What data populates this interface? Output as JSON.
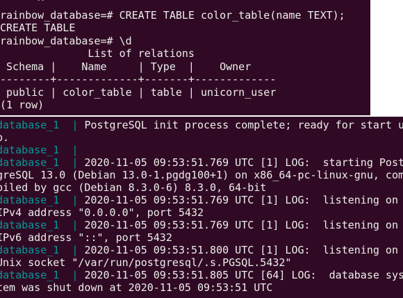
{
  "psql_window": {
    "lines": [
      "      ^",
      "rainbow_database=# CREATE TABLE color_table(name TEXT);",
      "CREATE TABLE",
      "rainbow_database=# \\d",
      "              List of relations",
      " Schema |    Name     | Type  |    Owner",
      "--------+-------------+-------+-------------",
      " public | color_table | table | unicorn_user",
      "(1 row)"
    ]
  },
  "log_window": {
    "prefix": "database_1  ",
    "separator": "| ",
    "colors": {
      "background": "#300a24",
      "prefix": "#06989a",
      "text": "#eeeeec"
    },
    "lines": [
      {
        "prefix": true,
        "text": "PostgreSQL init process complete; ready for start u"
      },
      {
        "prefix": false,
        "text": "p."
      },
      {
        "prefix": true,
        "text": ""
      },
      {
        "prefix": true,
        "text": "2020-11-05 09:53:51.769 UTC [1] LOG:  starting Post"
      },
      {
        "prefix": false,
        "text": "greSQL 13.0 (Debian 13.0-1.pgdg100+1) on x86_64-pc-linux-gnu, com"
      },
      {
        "prefix": false,
        "text": "piled by gcc (Debian 8.3.0-6) 8.3.0, 64-bit"
      },
      {
        "prefix": true,
        "text": "2020-11-05 09:53:51.769 UTC [1] LOG:  listening on"
      },
      {
        "prefix": false,
        "text": "IPv4 address \"0.0.0.0\", port 5432"
      },
      {
        "prefix": true,
        "text": "2020-11-05 09:53:51.769 UTC [1] LOG:  listening on"
      },
      {
        "prefix": false,
        "text": "IPv6 address \"::\", port 5432"
      },
      {
        "prefix": true,
        "text": "2020-11-05 09:53:51.800 UTC [1] LOG:  listening on"
      },
      {
        "prefix": false,
        "text": "Unix socket \"/var/run/postgresql/.s.PGSQL.5432\""
      },
      {
        "prefix": true,
        "text": "2020-11-05 09:53:51.805 UTC [64] LOG:  database sys"
      },
      {
        "prefix": false,
        "text": "tem was shut down at 2020-11-05 09:53:51 UTC"
      }
    ]
  }
}
